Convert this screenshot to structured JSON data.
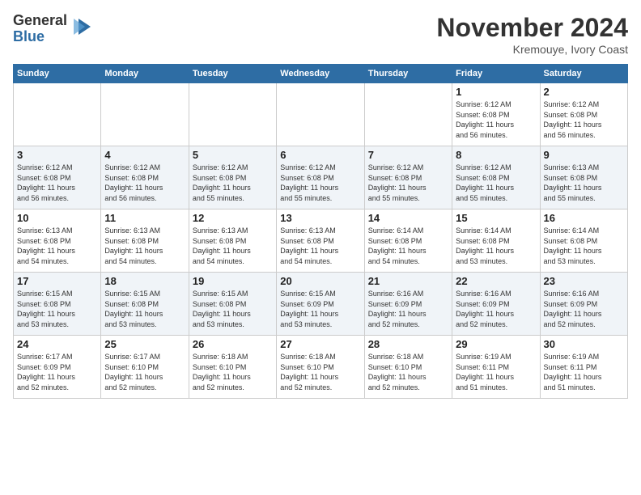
{
  "header": {
    "logo": {
      "line1": "General",
      "line2": "Blue"
    },
    "title": "November 2024",
    "location": "Kremouye, Ivory Coast"
  },
  "weekdays": [
    "Sunday",
    "Monday",
    "Tuesday",
    "Wednesday",
    "Thursday",
    "Friday",
    "Saturday"
  ],
  "weeks": [
    [
      {
        "day": "",
        "info": ""
      },
      {
        "day": "",
        "info": ""
      },
      {
        "day": "",
        "info": ""
      },
      {
        "day": "",
        "info": ""
      },
      {
        "day": "",
        "info": ""
      },
      {
        "day": "1",
        "info": "Sunrise: 6:12 AM\nSunset: 6:08 PM\nDaylight: 11 hours\nand 56 minutes."
      },
      {
        "day": "2",
        "info": "Sunrise: 6:12 AM\nSunset: 6:08 PM\nDaylight: 11 hours\nand 56 minutes."
      }
    ],
    [
      {
        "day": "3",
        "info": "Sunrise: 6:12 AM\nSunset: 6:08 PM\nDaylight: 11 hours\nand 56 minutes."
      },
      {
        "day": "4",
        "info": "Sunrise: 6:12 AM\nSunset: 6:08 PM\nDaylight: 11 hours\nand 56 minutes."
      },
      {
        "day": "5",
        "info": "Sunrise: 6:12 AM\nSunset: 6:08 PM\nDaylight: 11 hours\nand 55 minutes."
      },
      {
        "day": "6",
        "info": "Sunrise: 6:12 AM\nSunset: 6:08 PM\nDaylight: 11 hours\nand 55 minutes."
      },
      {
        "day": "7",
        "info": "Sunrise: 6:12 AM\nSunset: 6:08 PM\nDaylight: 11 hours\nand 55 minutes."
      },
      {
        "day": "8",
        "info": "Sunrise: 6:12 AM\nSunset: 6:08 PM\nDaylight: 11 hours\nand 55 minutes."
      },
      {
        "day": "9",
        "info": "Sunrise: 6:13 AM\nSunset: 6:08 PM\nDaylight: 11 hours\nand 55 minutes."
      }
    ],
    [
      {
        "day": "10",
        "info": "Sunrise: 6:13 AM\nSunset: 6:08 PM\nDaylight: 11 hours\nand 54 minutes."
      },
      {
        "day": "11",
        "info": "Sunrise: 6:13 AM\nSunset: 6:08 PM\nDaylight: 11 hours\nand 54 minutes."
      },
      {
        "day": "12",
        "info": "Sunrise: 6:13 AM\nSunset: 6:08 PM\nDaylight: 11 hours\nand 54 minutes."
      },
      {
        "day": "13",
        "info": "Sunrise: 6:13 AM\nSunset: 6:08 PM\nDaylight: 11 hours\nand 54 minutes."
      },
      {
        "day": "14",
        "info": "Sunrise: 6:14 AM\nSunset: 6:08 PM\nDaylight: 11 hours\nand 54 minutes."
      },
      {
        "day": "15",
        "info": "Sunrise: 6:14 AM\nSunset: 6:08 PM\nDaylight: 11 hours\nand 53 minutes."
      },
      {
        "day": "16",
        "info": "Sunrise: 6:14 AM\nSunset: 6:08 PM\nDaylight: 11 hours\nand 53 minutes."
      }
    ],
    [
      {
        "day": "17",
        "info": "Sunrise: 6:15 AM\nSunset: 6:08 PM\nDaylight: 11 hours\nand 53 minutes."
      },
      {
        "day": "18",
        "info": "Sunrise: 6:15 AM\nSunset: 6:08 PM\nDaylight: 11 hours\nand 53 minutes."
      },
      {
        "day": "19",
        "info": "Sunrise: 6:15 AM\nSunset: 6:08 PM\nDaylight: 11 hours\nand 53 minutes."
      },
      {
        "day": "20",
        "info": "Sunrise: 6:15 AM\nSunset: 6:09 PM\nDaylight: 11 hours\nand 53 minutes."
      },
      {
        "day": "21",
        "info": "Sunrise: 6:16 AM\nSunset: 6:09 PM\nDaylight: 11 hours\nand 52 minutes."
      },
      {
        "day": "22",
        "info": "Sunrise: 6:16 AM\nSunset: 6:09 PM\nDaylight: 11 hours\nand 52 minutes."
      },
      {
        "day": "23",
        "info": "Sunrise: 6:16 AM\nSunset: 6:09 PM\nDaylight: 11 hours\nand 52 minutes."
      }
    ],
    [
      {
        "day": "24",
        "info": "Sunrise: 6:17 AM\nSunset: 6:09 PM\nDaylight: 11 hours\nand 52 minutes."
      },
      {
        "day": "25",
        "info": "Sunrise: 6:17 AM\nSunset: 6:10 PM\nDaylight: 11 hours\nand 52 minutes."
      },
      {
        "day": "26",
        "info": "Sunrise: 6:18 AM\nSunset: 6:10 PM\nDaylight: 11 hours\nand 52 minutes."
      },
      {
        "day": "27",
        "info": "Sunrise: 6:18 AM\nSunset: 6:10 PM\nDaylight: 11 hours\nand 52 minutes."
      },
      {
        "day": "28",
        "info": "Sunrise: 6:18 AM\nSunset: 6:10 PM\nDaylight: 11 hours\nand 52 minutes."
      },
      {
        "day": "29",
        "info": "Sunrise: 6:19 AM\nSunset: 6:11 PM\nDaylight: 11 hours\nand 51 minutes."
      },
      {
        "day": "30",
        "info": "Sunrise: 6:19 AM\nSunset: 6:11 PM\nDaylight: 11 hours\nand 51 minutes."
      }
    ]
  ]
}
